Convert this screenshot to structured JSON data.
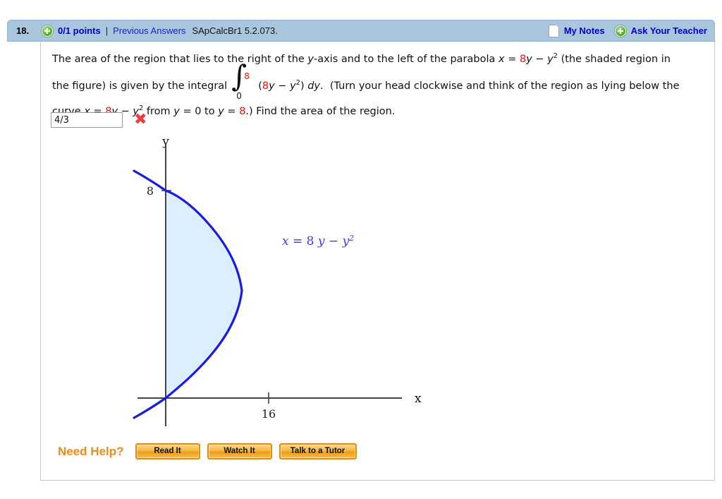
{
  "header": {
    "question_number": "18.",
    "points": "0/1 points",
    "separator": "|",
    "previous_answers": "Previous Answers",
    "book_code": "SApCalcBr1 5.2.073.",
    "my_notes": "My Notes",
    "ask_your_teacher": "Ask Your Teacher",
    "bar_color": "#a9c6de",
    "link_color": "#0000cc"
  },
  "question": {
    "line1_a": "The area of the region that lies to the right of the ",
    "line1_y": "y",
    "line1_b": "-axis and to the left of the parabola  ",
    "line1_x": "x",
    "line1_eq": " = ",
    "line1_eight": "8",
    "line1_yvar": "y",
    "line1_minus": " − ",
    "line1_ysq": "y",
    "line1_sup": "2",
    "line1_c": "  (the shaded region in",
    "line2_a": "the figure) is given by the integral",
    "integral_upper": "8",
    "integral_lower": "0",
    "integral_symbol": "∫",
    "line2_paren_open": "(",
    "line2_eight": "8",
    "line2_y": "y",
    "line2_minus": " − ",
    "line2_ysq": "y",
    "line2_sup": "2",
    "line2_paren_close": ") ",
    "line2_dy": "dy",
    "line2_period": ".",
    "line2_b": "(Turn your head clockwise and think of the region as lying below the",
    "line3_a": "curve  ",
    "line3_x": "x",
    "line3_eq": " = ",
    "line3_eight": "8",
    "line3_y": "y",
    "line3_minus": " − ",
    "line3_ysq": "y",
    "line3_sup": "2",
    "line3_from": "  from ",
    "line3_y2": "y",
    "line3_zero": " = 0 to ",
    "line3_y3": "y",
    "line3_eq8a": " = ",
    "line3_eight2": "8",
    "line3_b": ".) Find the area of the region.",
    "red_color": "#e8120c"
  },
  "answer": {
    "value": "4/3",
    "placeholder": "",
    "status_mark": "✖",
    "status_color": "#ef3b45"
  },
  "chart_data": {
    "type": "area",
    "title": "",
    "curve_label": "x = 8 y − y²",
    "curve_label_parts": {
      "x": "x",
      "eq": " = ",
      "eight": "8 ",
      "y": "y",
      "minus": " − ",
      "ysq": "y",
      "sup": "2"
    },
    "xlabel": "x",
    "ylabel": "y",
    "x_ticks": [
      {
        "value": 16,
        "label": "16"
      }
    ],
    "y_ticks": [
      {
        "value": 8,
        "label": "8"
      }
    ],
    "xlim": [
      -4,
      26
    ],
    "ylim": [
      -2.5,
      10.5
    ],
    "equation": "x = 8y - y^2",
    "shaded_region": "between curve and y-axis for y in [0, 8]",
    "integral_lower_limit": 0,
    "integral_upper_limit": 8,
    "curve_color": "#1a1ae0",
    "fill_color": "#ddeeff",
    "axis_color": "#444444",
    "grid": false,
    "legend": "none"
  },
  "need_help": {
    "label": "Need Help?",
    "buttons": [
      {
        "label": "Read It"
      },
      {
        "label": "Watch It"
      },
      {
        "label": "Talk to a Tutor"
      }
    ],
    "accent_color": "#f08b18"
  }
}
